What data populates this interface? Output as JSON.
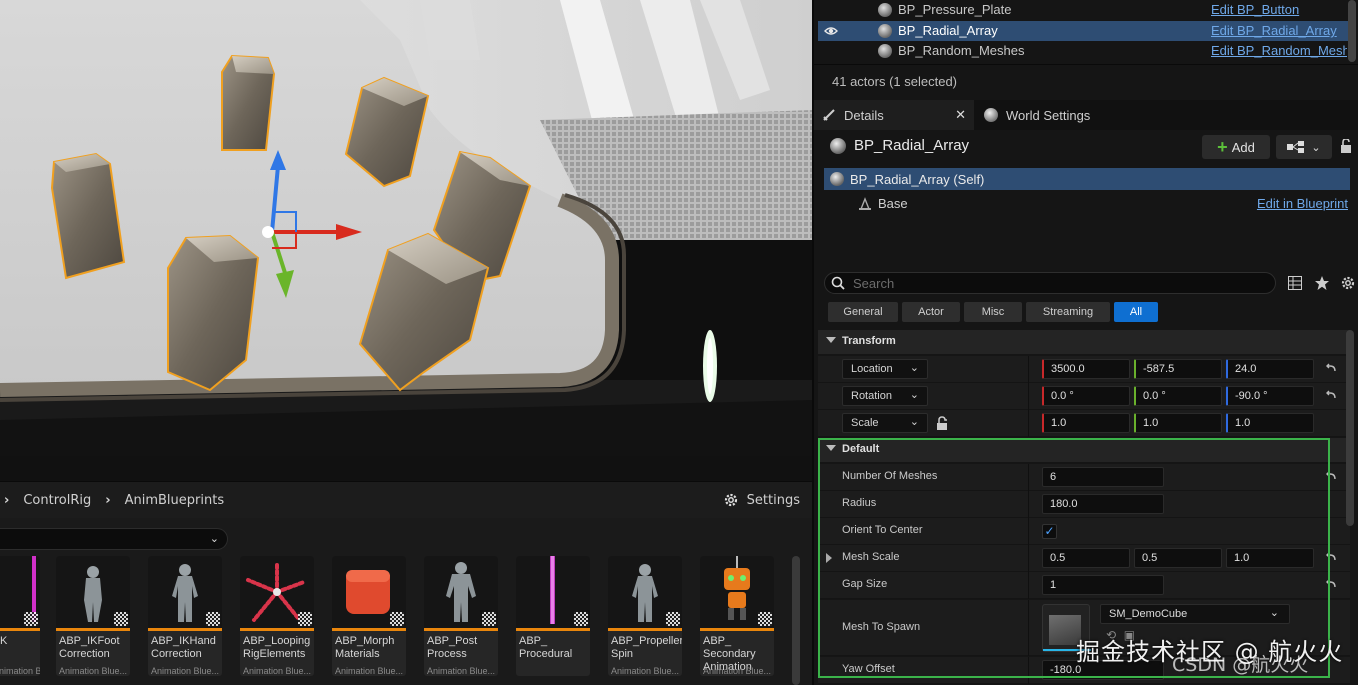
{
  "outliner": {
    "rows": [
      {
        "name": "BP_Pressure_Plate",
        "link": "Edit BP_Button",
        "selected": false
      },
      {
        "name": "BP_Radial_Array",
        "link": "Edit BP_Radial_Array",
        "selected": true
      },
      {
        "name": "BP_Random_Meshes",
        "link": "Edit BP_Random_Meshes",
        "selected": false
      }
    ],
    "actors_count": "41 actors (1 selected)"
  },
  "tabs": {
    "details": "Details",
    "world_settings": "World Settings"
  },
  "details": {
    "actor_name": "BP_Radial_Array",
    "add_label": "Add",
    "components": {
      "self": "BP_Radial_Array (Self)",
      "base": "Base",
      "edit_link": "Edit in Blueprint"
    },
    "search_placeholder": "Search",
    "filters": [
      "General",
      "Actor",
      "Misc",
      "Streaming",
      "All"
    ],
    "active_filter": "All",
    "transform": {
      "title": "Transform",
      "location": {
        "label": "Location",
        "x": "3500.0",
        "y": "-587.5",
        "z": "24.0"
      },
      "rotation": {
        "label": "Rotation",
        "x": "0.0 °",
        "y": "0.0 °",
        "z": "-90.0 °"
      },
      "scale": {
        "label": "Scale",
        "x": "1.0",
        "y": "1.0",
        "z": "1.0"
      }
    },
    "default": {
      "title": "Default",
      "number_of_meshes": {
        "label": "Number Of Meshes",
        "value": "6"
      },
      "radius": {
        "label": "Radius",
        "value": "180.0"
      },
      "orient_to_center": {
        "label": "Orient To Center",
        "checked": true
      },
      "mesh_scale": {
        "label": "Mesh Scale",
        "x": "0.5",
        "y": "0.5",
        "z": "1.0"
      },
      "gap_size": {
        "label": "Gap Size",
        "value": "1"
      },
      "mesh_to_spawn": {
        "label": "Mesh To Spawn",
        "value": "SM_DemoCube"
      },
      "yaw_offset": {
        "label": "Yaw Offset",
        "value": "-180.0"
      }
    }
  },
  "content_browser": {
    "path": [
      "ControlRig",
      "AnimBlueprints"
    ],
    "settings_label": "Settings",
    "assets": [
      {
        "name": "K",
        "type": "nimation Blue..."
      },
      {
        "name": "ABP_IKFoot\nCorrection",
        "type": "Animation Blue..."
      },
      {
        "name": "ABP_IKHand\nCorrection",
        "type": "Animation Blue..."
      },
      {
        "name": "ABP_Looping\nRigElements",
        "type": "Animation Blue..."
      },
      {
        "name": "ABP_Morph\nMaterials",
        "type": "Animation Blue..."
      },
      {
        "name": "ABP_Post\nProcess",
        "type": "Animation Blue..."
      },
      {
        "name": "ABP_\nProcedural",
        "type": ""
      },
      {
        "name": "ABP_Propeller\nSpin",
        "type": "Animation Blue..."
      },
      {
        "name": "ABP_\nSecondary\nAnimation",
        "type": "Animation Blue..."
      }
    ]
  },
  "watermark": "掘金技术社区 @ 航火火",
  "watermark2": "CSDN @航火火"
}
